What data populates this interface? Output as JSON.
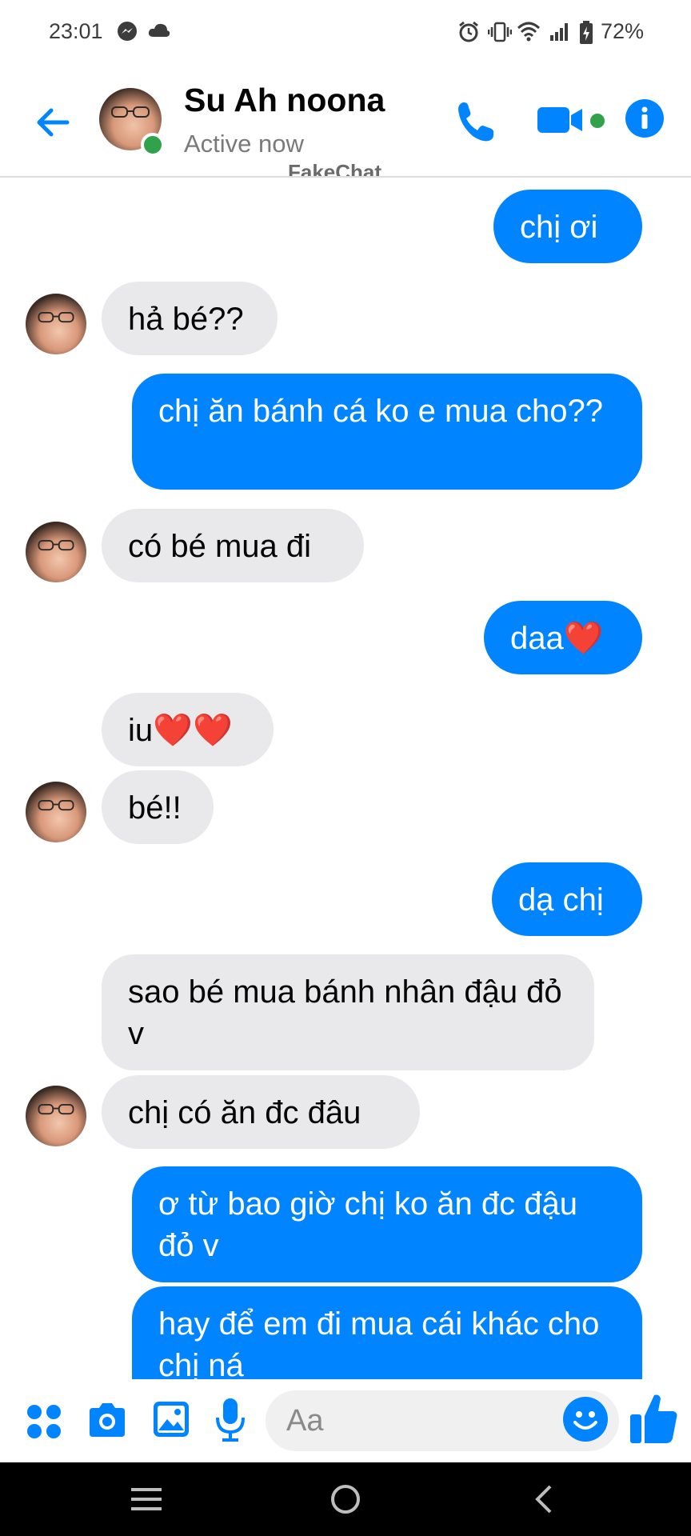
{
  "status_bar": {
    "time": "23:01",
    "battery": "72%",
    "icons": [
      "messenger-icon",
      "cloud-icon",
      "alarm-icon",
      "vibrate-icon",
      "wifi-icon",
      "signal-icon",
      "battery-icon"
    ]
  },
  "header": {
    "name": "Su Ah noona",
    "status": "Active now",
    "watermark": "FakeChat",
    "accent_color": "#0084ff",
    "online_color": "#31a24c"
  },
  "messages": [
    {
      "from": "me",
      "text": "chị ơi"
    },
    {
      "from": "them",
      "text": "hả bé??"
    },
    {
      "from": "me",
      "text": "chị ăn bánh cá ko e mua cho??"
    },
    {
      "from": "them",
      "text": "có bé mua đi"
    },
    {
      "from": "me",
      "text": "daa❤️"
    },
    {
      "from": "them",
      "text": "iu❤️❤️"
    },
    {
      "from": "them",
      "text": "bé!!"
    },
    {
      "from": "me",
      "text": "dạ chị"
    },
    {
      "from": "them",
      "text": "sao bé mua bánh nhân đậu đỏ v"
    },
    {
      "from": "them",
      "text": "chị có ăn đc đâu"
    },
    {
      "from": "me",
      "text": "ơ từ bao giờ chị ko ăn đc đậu đỏ v"
    },
    {
      "from": "me",
      "text": "hay để em đi mua cái khác cho chị ná"
    }
  ],
  "composer": {
    "placeholder": "Aa",
    "icons": [
      "apps-icon",
      "camera-icon",
      "gallery-icon",
      "microphone-icon",
      "emoji-icon",
      "thumbs-up-icon"
    ]
  },
  "nav_bar": {
    "icons": [
      "recent-apps-icon",
      "home-icon",
      "back-icon"
    ]
  }
}
